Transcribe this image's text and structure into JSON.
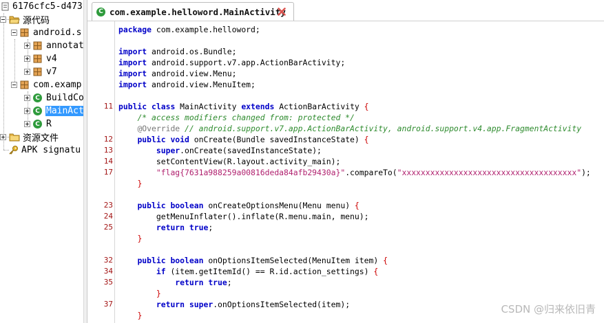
{
  "tree": {
    "root": "6176cfc5-d473-",
    "source": "源代码",
    "pkg_android": "android.s",
    "annot": "annotat",
    "v4": "v4",
    "v7": "v7",
    "pkg_com": "com.examp",
    "buildconfig": "BuildCo",
    "mainactivity": "MainAct",
    "r": "R",
    "resources": "资源文件",
    "apk_signature": "APK signatu"
  },
  "tab": {
    "title": "com.example.helloword.MainActivity"
  },
  "code": {
    "l1": {
      "kw": "package",
      "rest": " com.example.helloword;"
    },
    "l3": {
      "kw": "import",
      "rest": " android.os.Bundle;"
    },
    "l4": {
      "kw": "import",
      "rest": " android.support.v7.app.ActionBarActivity;"
    },
    "l5": {
      "kw": "import",
      "rest": " android.view.Menu;"
    },
    "l6": {
      "kw": "import",
      "rest": " android.view.MenuItem;"
    },
    "l8": {
      "num": "11",
      "kw1": "public",
      "kw2": "class",
      "name": " MainActivity ",
      "kw3": "extends",
      "rest": " ActionBarActivity ",
      "brace": "{"
    },
    "l9": {
      "comment": "/* access modifiers changed from: protected */"
    },
    "l10": {
      "annot": "@Override",
      "comment": " // android.support.v7.app.ActionBarActivity, android.support.v4.app.FragmentActivity"
    },
    "l11": {
      "num": "12",
      "kw1": "public",
      "kw2": "void",
      "rest": " onCreate(Bundle savedInstanceState) ",
      "brace": "{"
    },
    "l12": {
      "num": "13",
      "kw": "super",
      "rest": ".onCreate(savedInstanceState);"
    },
    "l13": {
      "num": "14",
      "rest": "setContentView(R.layout.activity_main);"
    },
    "l14": {
      "num": "17",
      "str1": "\"flag{7631a988259a00816deda84afb29430a}\"",
      "mid": ".compareTo(",
      "str2": "\"xxxxxxxxxxxxxxxxxxxxxxxxxxxxxxxxxxxxx\"",
      "end": ");"
    },
    "l15": {
      "brace": "}"
    },
    "l17": {
      "num": "23",
      "kw1": "public",
      "kw2": "boolean",
      "rest": " onCreateOptionsMenu(Menu menu) ",
      "brace": "{"
    },
    "l18": {
      "num": "24",
      "rest": "getMenuInflater().inflate(R.menu.main, menu);"
    },
    "l19": {
      "num": "25",
      "kw": "return",
      "kw2": "true",
      "end": ";"
    },
    "l20": {
      "brace": "}"
    },
    "l22": {
      "num": "32",
      "kw1": "public",
      "kw2": "boolean",
      "rest": " onOptionsItemSelected(MenuItem item) ",
      "brace": "{"
    },
    "l23": {
      "num": "34",
      "kw": "if",
      "rest": " (item.getItemId() == R.id.action_settings) ",
      "brace": "{"
    },
    "l24": {
      "num": "35",
      "kw": "return",
      "kw2": "true",
      "end": ";"
    },
    "l25": {
      "brace": "}"
    },
    "l26": {
      "num": "37",
      "kw": "return",
      "kw2": "super",
      "rest": ".onOptionsItemSelected(item);"
    },
    "l27": {
      "brace": "}"
    }
  },
  "watermark": "CSDN @归来依旧青"
}
